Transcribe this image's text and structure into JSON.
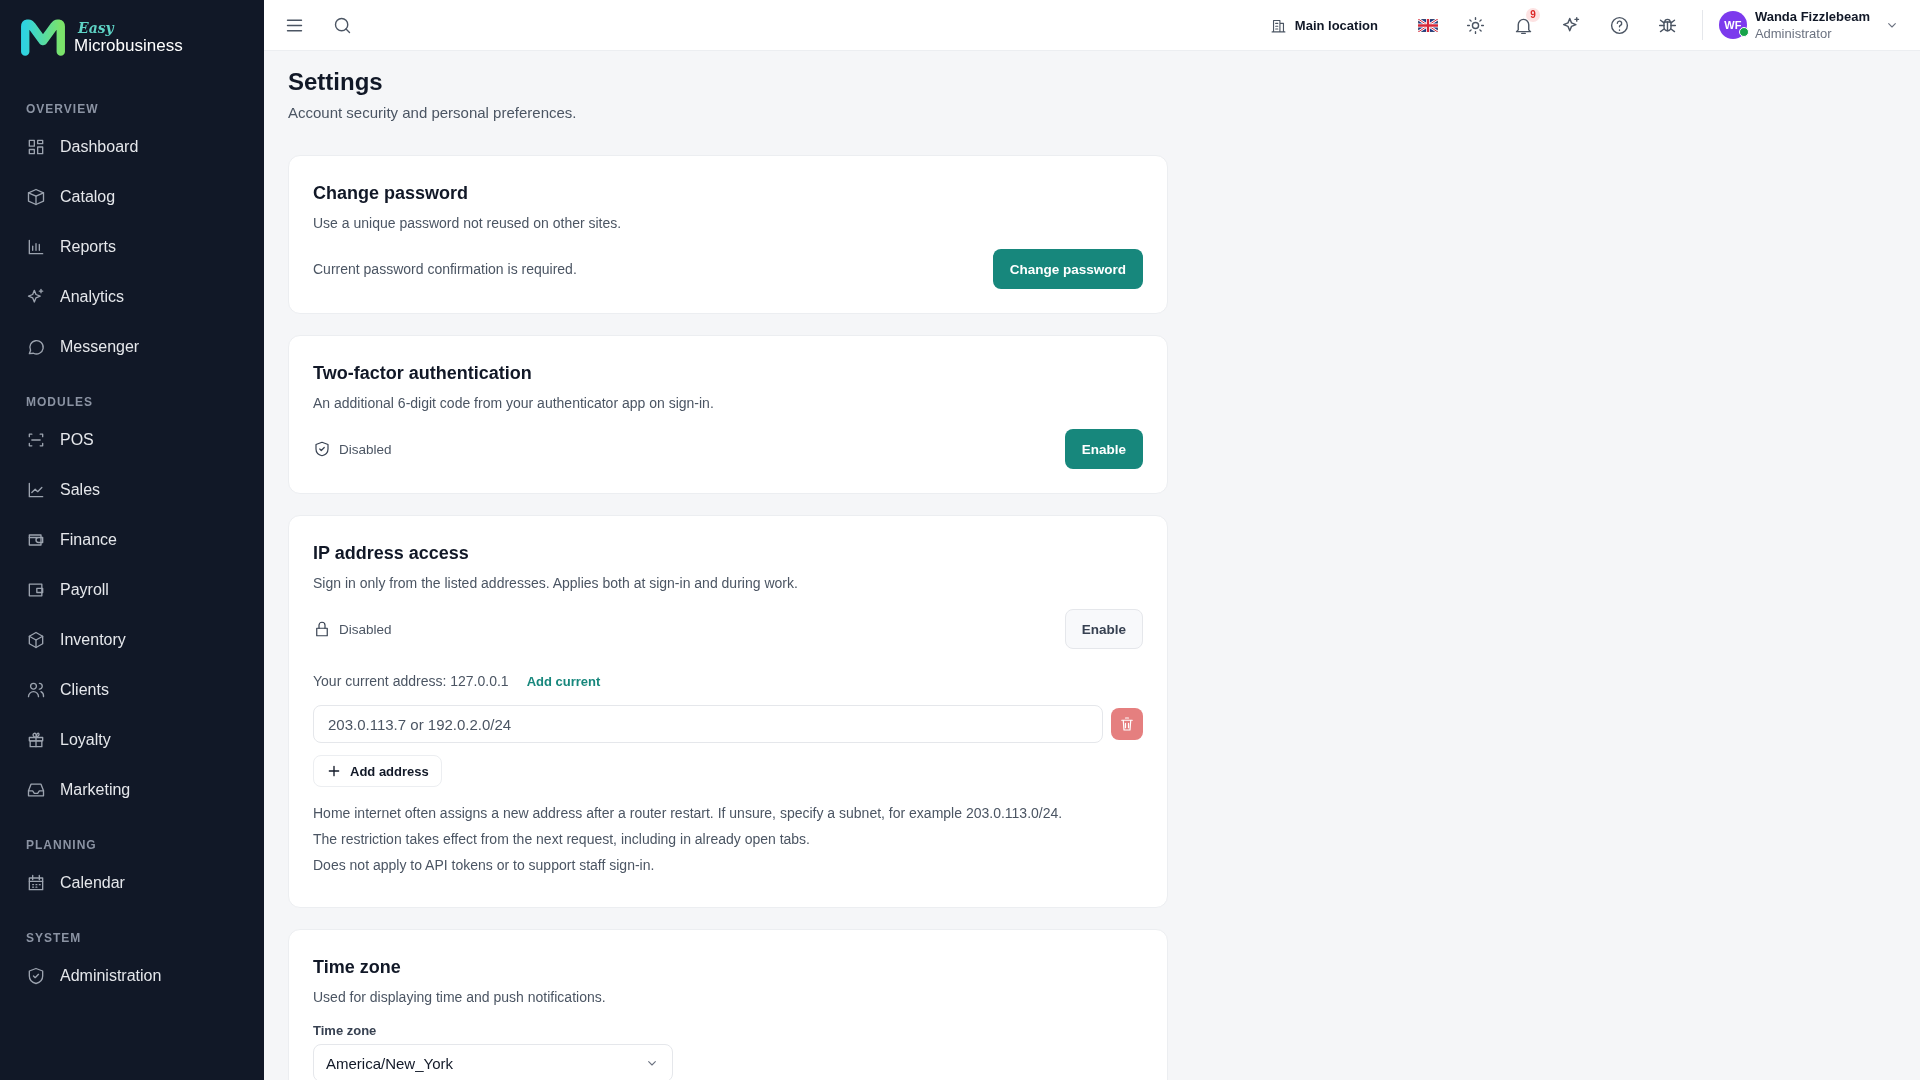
{
  "brand": {
    "script": "Easy",
    "name": "Microbusiness"
  },
  "sidebar": {
    "sections": [
      {
        "heading": "OVERVIEW",
        "items": [
          {
            "label": "Dashboard"
          },
          {
            "label": "Catalog"
          },
          {
            "label": "Reports"
          },
          {
            "label": "Analytics"
          },
          {
            "label": "Messenger"
          }
        ]
      },
      {
        "heading": "MODULES",
        "items": [
          {
            "label": "POS"
          },
          {
            "label": "Sales"
          },
          {
            "label": "Finance"
          },
          {
            "label": "Payroll"
          },
          {
            "label": "Inventory"
          },
          {
            "label": "Clients"
          },
          {
            "label": "Loyalty"
          },
          {
            "label": "Marketing"
          }
        ]
      },
      {
        "heading": "PLANNING",
        "items": [
          {
            "label": "Calendar"
          }
        ]
      },
      {
        "heading": "SYSTEM",
        "items": [
          {
            "label": "Administration"
          }
        ]
      }
    ]
  },
  "topbar": {
    "location": "Main location",
    "notifications": "9",
    "user": {
      "initials": "WF",
      "name": "Wanda Fizzlebeam",
      "role": "Administrator",
      "online": true
    }
  },
  "page": {
    "title": "Settings",
    "subtitle": "Account security and personal preferences."
  },
  "cards": [
    {
      "kind": "password",
      "title": "Change password",
      "description": "Use a unique password not reused on other sites.",
      "note": "Current password confirmation is required.",
      "button": {
        "label": "Change password",
        "disabled": false
      }
    },
    {
      "kind": "status",
      "title": "Two-factor authentication",
      "description": "An additional 6-digit code from your authenticator app on sign-in.",
      "status": "Disabled",
      "button": {
        "label": "Enable",
        "disabled": false
      }
    },
    {
      "kind": "ip",
      "title": "IP address access",
      "description": "Sign in only from the listed addresses. Applies both at sign-in and during work.",
      "status": "Disabled",
      "button": {
        "label": "Enable",
        "disabled": true
      },
      "current_address": "Your current address: 127.0.0.1",
      "add_current": "Add current",
      "entries": [
        {
          "placeholder": "203.0.113.7 or 192.0.2.0/24"
        }
      ],
      "add_button": "Add address",
      "notes": [
        "Home internet often assigns a new address after a router restart. If unsure, specify a subnet, for example 203.0.113.0/24.",
        "The restriction takes effect from the next request, including in already open tabs.",
        "Does not apply to API tokens or to support staff sign-in."
      ]
    },
    {
      "kind": "timezone",
      "title": "Time zone",
      "description": "Used for displaying time and push notifications.",
      "field_label": "Time zone",
      "value": "America/New_York"
    }
  ]
}
